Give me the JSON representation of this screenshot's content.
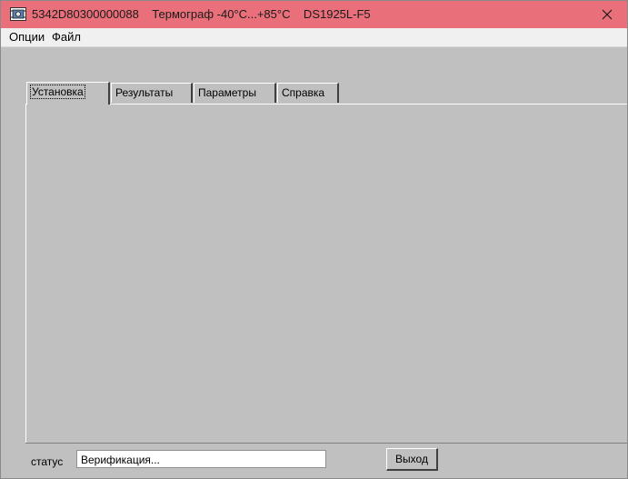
{
  "window": {
    "title": "5342D80300000088    Термограф -40°С...+85°С    DS1925L-F5",
    "app_icon": "device-chip-icon",
    "close_icon": "close-icon"
  },
  "menu": {
    "items": [
      "Опции",
      "Файл"
    ]
  },
  "tabs": [
    {
      "label": "Установка",
      "active": true
    },
    {
      "label": "Результаты",
      "active": false
    },
    {
      "label": "Параметры",
      "active": false
    },
    {
      "label": "Справка",
      "active": false
    }
  ],
  "status": {
    "label": "статус",
    "value": "Верификация..."
  },
  "buttons": {
    "exit": "Выход"
  },
  "colors": {
    "titlebar": "#e9707a",
    "window_bg": "#c0c0c0",
    "menubar": "#f0f0f0"
  }
}
